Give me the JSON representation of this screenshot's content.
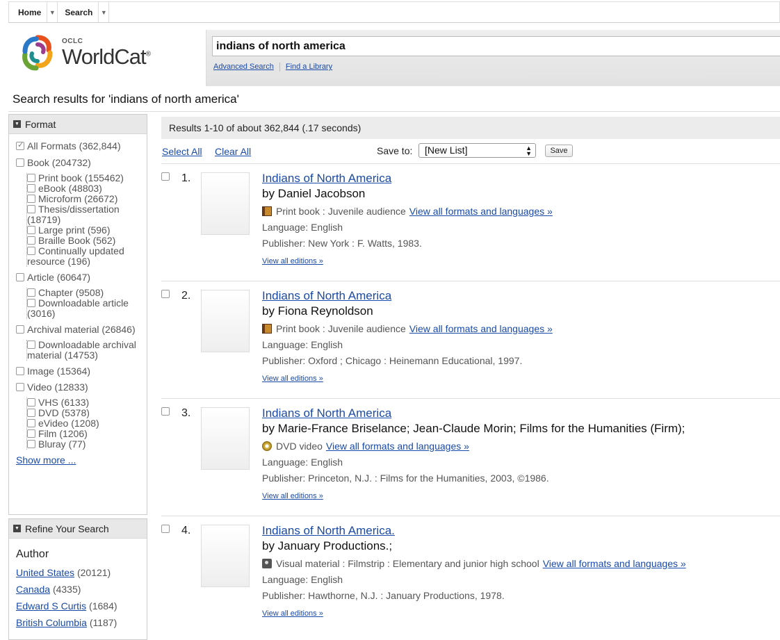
{
  "nav": {
    "home": "Home",
    "search": "Search"
  },
  "logo": {
    "oclc": "OCLC",
    "worldcat": "WorldCat",
    "reg": "®"
  },
  "search": {
    "value": "indians of north america",
    "advanced": "Advanced Search",
    "find_library": "Find a Library"
  },
  "results_title": "Search results for 'indians of north america'",
  "format_facet": {
    "heading": "Format",
    "items": [
      {
        "label": "All Formats (362,844)",
        "checked": true
      },
      {
        "label": "Book (204732)",
        "sub": [
          "Print book (155462)",
          "eBook (48803)",
          "Microform (26672)",
          "Thesis/dissertation (18719)",
          "Large print (596)",
          "Braille Book (562)",
          "Continually updated resource (196)"
        ]
      },
      {
        "label": "Article (60647)",
        "sub": [
          "Chapter (9508)",
          "Downloadable article (3016)"
        ]
      },
      {
        "label": "Archival material (26846)",
        "sub": [
          "Downloadable archival material (14753)"
        ]
      },
      {
        "label": "Image (15364)"
      },
      {
        "label": "Video (12833)",
        "sub": [
          "VHS (6133)",
          "DVD (5378)",
          "eVideo (1208)",
          "Film (1206)",
          "Bluray (77)"
        ]
      }
    ],
    "show_more": "Show more ..."
  },
  "refine": {
    "heading": "Refine Your Search",
    "author_heading": "Author",
    "authors": [
      {
        "name": "United States",
        "count": "(20121)"
      },
      {
        "name": "Canada",
        "count": "(4335)"
      },
      {
        "name": "Edward S Curtis",
        "count": "(1684)"
      },
      {
        "name": "British Columbia",
        "count": "(1187)"
      }
    ]
  },
  "results_summary": "Results 1-10 of about 362,844 (.17 seconds)",
  "toolbar": {
    "select_all": "Select All",
    "clear_all": "Clear All",
    "save_to": "Save to:",
    "list_value": "[New List]",
    "save": "Save"
  },
  "results": [
    {
      "num": "1.",
      "title": "Indians of North America",
      "by": "by Daniel Jacobson",
      "icon": "book-icon",
      "format": "Print book : Juvenile audience",
      "formats_link": "View all formats and languages »",
      "language": "Language: English",
      "publisher": "Publisher: New York : F. Watts, 1983.",
      "editions": "View all editions »"
    },
    {
      "num": "2.",
      "title": "Indians of North America",
      "by": "by Fiona Reynoldson",
      "icon": "book-icon",
      "format": "Print book : Juvenile audience",
      "formats_link": "View all formats and languages »",
      "language": "Language: English",
      "publisher": "Publisher: Oxford ; Chicago : Heinemann Educational, 1997.",
      "editions": "View all editions »"
    },
    {
      "num": "3.",
      "title": "Indians of North America",
      "by": "by Marie-France Briselance; Jean-Claude Morin; Films for the Humanities (Firm);",
      "icon": "dvd-icon",
      "format": "DVD video",
      "formats_link": "View all formats and languages »",
      "language": "Language: English",
      "publisher": "Publisher: Princeton, N.J. : Films for the Humanities, 2003, ©1986.",
      "editions": "View all editions »"
    },
    {
      "num": "4.",
      "title": "Indians of North America.",
      "by": "by January Productions.;",
      "icon": "camera-icon",
      "format": "Visual material : Filmstrip : Elementary and junior high school",
      "formats_link": "View all formats and languages »",
      "language": "Language: English",
      "publisher": "Publisher: Hawthorne, N.J. : January Productions, 1978.",
      "editions": "View all editions »"
    }
  ]
}
